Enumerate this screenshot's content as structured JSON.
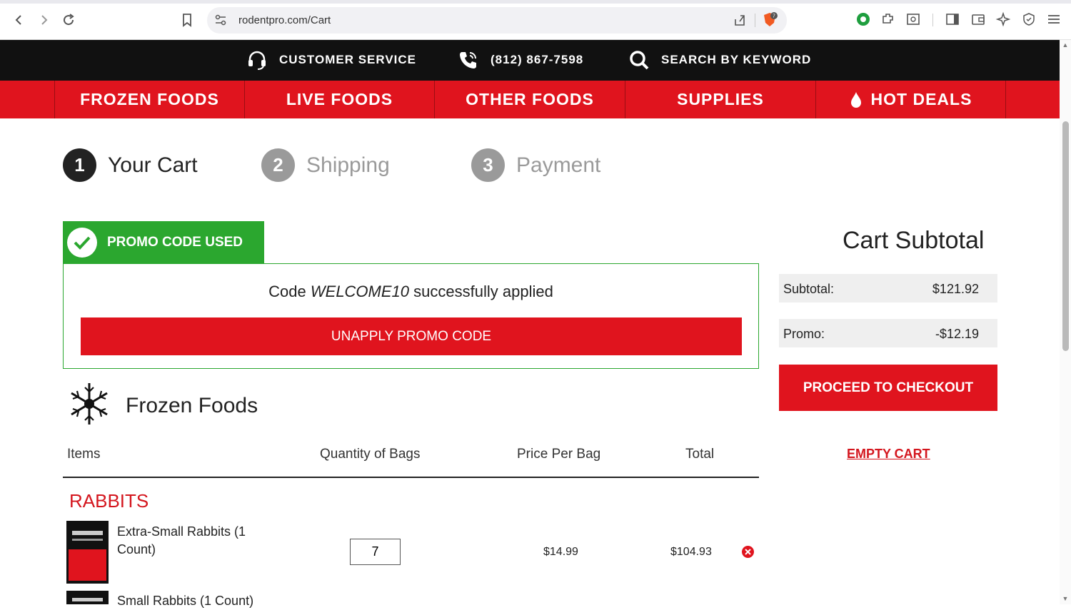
{
  "browser": {
    "url": "rodentpro.com/Cart",
    "shield_count": "7"
  },
  "topbar": {
    "customer_service": "CUSTOMER SERVICE",
    "phone": "(812) 867-7598",
    "search": "SEARCH BY KEYWORD"
  },
  "nav": {
    "items": [
      "FROZEN FOODS",
      "LIVE FOODS",
      "OTHER FOODS",
      "SUPPLIES",
      "HOT DEALS"
    ]
  },
  "steps": [
    {
      "num": "1",
      "label": "Your Cart",
      "active": true
    },
    {
      "num": "2",
      "label": "Shipping",
      "active": false
    },
    {
      "num": "3",
      "label": "Payment",
      "active": false
    }
  ],
  "promo": {
    "tab_label": "PROMO CODE USED",
    "msg_prefix": "Code",
    "code": "WELCOME10",
    "msg_suffix": "successfully applied",
    "unapply_label": "UNAPPLY PROMO CODE"
  },
  "subtotal": {
    "title": "Cart Subtotal",
    "subtotal_label": "Subtotal:",
    "subtotal_value": "$121.92",
    "promo_label": "Promo:",
    "promo_value": "-$12.19",
    "checkout_label": "PROCEED TO CHECKOUT",
    "empty_label": "EMPTY CART"
  },
  "section": {
    "title": "Frozen Foods",
    "columns": [
      "Items",
      "Quantity of Bags",
      "Price Per Bag",
      "Total"
    ],
    "category": "RABBITS",
    "items": [
      {
        "name": "Extra-Small Rabbits (1 Count)",
        "qty": "7",
        "price": "$14.99",
        "total": "$104.93"
      },
      {
        "name": "Small Rabbits (1 Count)"
      }
    ]
  },
  "colors": {
    "brand_red": "#e0141e",
    "promo_green": "#2ba72f",
    "header_black": "#111111"
  }
}
